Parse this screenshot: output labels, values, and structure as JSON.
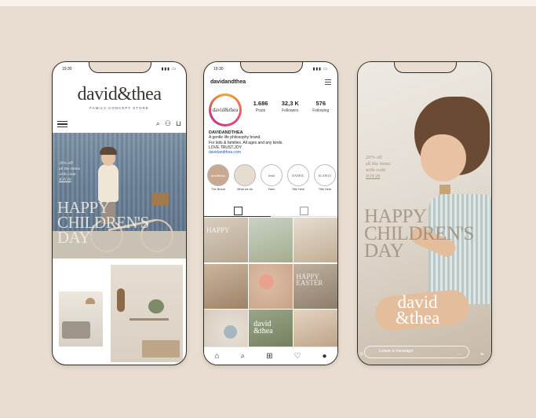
{
  "status": {
    "time": "19:30"
  },
  "phone1": {
    "logo": "david&thea",
    "tagline": "FAMILY CONCEPT STORE",
    "promo": [
      "20% off",
      "all the items",
      "with code",
      "JOY20"
    ],
    "headline": [
      "HAPPY",
      "CHILDREN'S",
      "DAY"
    ]
  },
  "phone2": {
    "username": "davidandthea",
    "avatar_text": "david&thea",
    "stats": [
      {
        "value": "1.686",
        "label": "Posts"
      },
      {
        "value": "32,3 K",
        "label": "Followers"
      },
      {
        "value": "576",
        "label": "Following"
      }
    ],
    "bio": {
      "name": "DAVIDANDTHEA",
      "lines": [
        "A gentle life philosophy brand.",
        "For kids & families. All ages and any kinds.",
        "LOVE.TRUST.JOY"
      ],
      "link": "davidandthea.com"
    },
    "highlights": [
      {
        "label": "The Brand",
        "icon": "david&thea"
      },
      {
        "label": "What we do",
        "icon": ""
      },
      {
        "label": "Farm",
        "icon": "ferml"
      },
      {
        "label": "Title Here",
        "icon": "DANIOC"
      },
      {
        "label": "Title Here",
        "icon": "ELANGO"
      }
    ],
    "grid": {
      "cell1": [
        "HAPPY"
      ],
      "cell6": [
        "HAPPY",
        "EASTER"
      ],
      "cell8": [
        "david",
        "&thea"
      ]
    }
  },
  "phone3": {
    "promo": [
      "20% off",
      "all the items",
      "with code",
      "JOY20"
    ],
    "headline": [
      "HAPPY",
      "CHILDREN'S",
      "DAY"
    ],
    "logo": [
      "david",
      "&thea"
    ],
    "message_placeholder": "Leave a message"
  },
  "colors": {
    "background": "#e8ddd0",
    "accent": "#c13584",
    "link": "#2b5aa8"
  }
}
